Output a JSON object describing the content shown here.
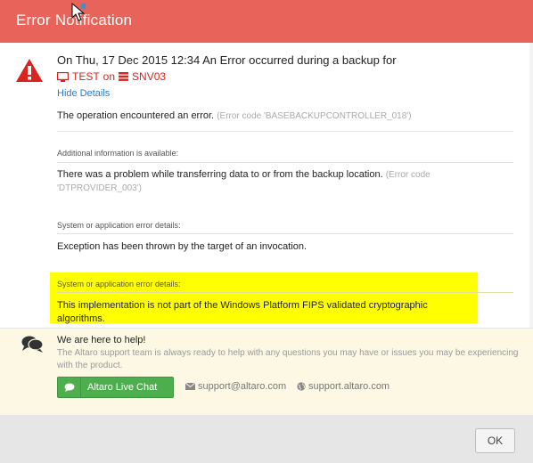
{
  "window": {
    "title": "Error Notification"
  },
  "header": {
    "headline": "On Thu, 17 Dec 2015 12:34 An Error occurred during a backup for",
    "target_machine": "TEST",
    "target_on": "on",
    "target_vm": "SNV03",
    "hide_details_label": "Hide Details"
  },
  "details": {
    "msg1": "The operation encountered an error.",
    "code1": "(Error code 'BASEBACKUPCONTROLLER_018')",
    "label1": "Additional information is available:",
    "msg2": "There was a problem while transferring data to or from the backup location.",
    "code2": "(Error code 'DTPROVIDER_003')",
    "label2": "System or application error details:",
    "msg3": "Exception has been thrown by the target of an invocation.",
    "label3": "System or application error details:",
    "msg4": "This implementation is not part of the Windows Platform FIPS validated cryptographic algorithms."
  },
  "help": {
    "title": "We are here to help!",
    "text": "The Altaro support team is always ready to help with any questions you may have or issues you may be experiencing with the product.",
    "chat_label": "Altaro Live Chat",
    "email": "support@altaro.com",
    "website": "support.altaro.com"
  },
  "footer": {
    "ok_label": "OK"
  },
  "colors": {
    "titlebar": "#e8645a",
    "error_red": "#d9251d",
    "link_blue": "#2a79c8",
    "chat_green": "#4dae4d",
    "highlight": "#ffff00",
    "help_bg": "#fcf8e3"
  }
}
